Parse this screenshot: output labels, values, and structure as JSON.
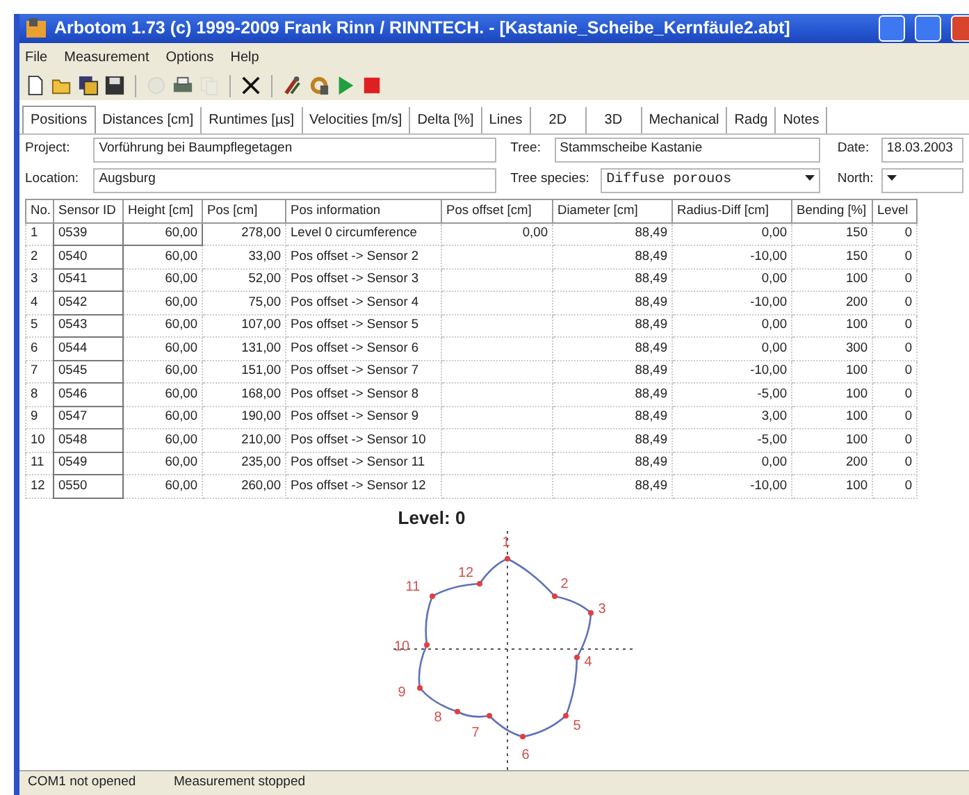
{
  "window": {
    "title": "Arbotom 1.73 (c) 1999-2009 Frank Rinn / RINNTECH.  - [Kastanie_Scheibe_Kernfäule2.abt]"
  },
  "menu": [
    "File",
    "Measurement",
    "Options",
    "Help"
  ],
  "toolbar": [
    {
      "kind": "new",
      "disabled": false
    },
    {
      "kind": "open",
      "disabled": false
    },
    {
      "kind": "saveall",
      "disabled": false
    },
    {
      "kind": "save",
      "disabled": false
    },
    {
      "kind": "sep"
    },
    {
      "kind": "print",
      "disabled": true
    },
    {
      "kind": "printer",
      "disabled": false
    },
    {
      "kind": "copy",
      "disabled": true
    },
    {
      "kind": "sep"
    },
    {
      "kind": "delete",
      "disabled": false
    },
    {
      "kind": "sep"
    },
    {
      "kind": "tools",
      "disabled": false
    },
    {
      "kind": "refresh",
      "disabled": false
    },
    {
      "kind": "play",
      "disabled": false
    },
    {
      "kind": "stop",
      "disabled": false
    }
  ],
  "tabs": [
    {
      "label": "Positions",
      "selected": true
    },
    {
      "label": "Distances [cm]",
      "selected": false
    },
    {
      "label": "Runtimes [µs]",
      "selected": false
    },
    {
      "label": "Velocities [m/s]",
      "selected": false
    },
    {
      "label": "Delta [%]",
      "selected": false
    },
    {
      "label": "Lines",
      "selected": false
    },
    {
      "label": "2D",
      "selected": false
    },
    {
      "label": "3D",
      "selected": false
    },
    {
      "label": "Mechanical",
      "selected": false
    },
    {
      "label": "Radg",
      "selected": false
    },
    {
      "label": "Notes",
      "selected": false
    }
  ],
  "form": {
    "project_label": "Project:",
    "project": "Vorführung bei Baumpflegetagen",
    "tree_label": "Tree:",
    "tree": "Stammscheibe Kastanie",
    "date_label": "Date:",
    "date": "18.03.2003",
    "location_label": "Location:",
    "location": "Augsburg",
    "species_label": "Tree species:",
    "species": "Diffuse porouos",
    "north_label": "North:"
  },
  "table": {
    "columns": [
      "No.",
      "Sensor ID",
      "Height [cm]",
      "Pos [cm]",
      "Pos information",
      "Pos offset [cm]",
      "Diameter [cm]",
      "Radius-Diff [cm]",
      "Bending [%]",
      "Level"
    ],
    "rows": [
      [
        "1",
        "0539",
        "60,00",
        "278,00",
        "Level 0 circumference",
        "0,00",
        "88,49",
        "0,00",
        "150",
        "0"
      ],
      [
        "2",
        "0540",
        "60,00",
        "33,00",
        "Pos offset -> Sensor 2",
        "",
        "88,49",
        "-10,00",
        "150",
        "0"
      ],
      [
        "3",
        "0541",
        "60,00",
        "52,00",
        "Pos offset -> Sensor 3",
        "",
        "88,49",
        "0,00",
        "100",
        "0"
      ],
      [
        "4",
        "0542",
        "60,00",
        "75,00",
        "Pos offset -> Sensor 4",
        "",
        "88,49",
        "-10,00",
        "200",
        "0"
      ],
      [
        "5",
        "0543",
        "60,00",
        "107,00",
        "Pos offset -> Sensor 5",
        "",
        "88,49",
        "0,00",
        "100",
        "0"
      ],
      [
        "6",
        "0544",
        "60,00",
        "131,00",
        "Pos offset -> Sensor 6",
        "",
        "88,49",
        "0,00",
        "300",
        "0"
      ],
      [
        "7",
        "0545",
        "60,00",
        "151,00",
        "Pos offset -> Sensor 7",
        "",
        "88,49",
        "-10,00",
        "100",
        "0"
      ],
      [
        "8",
        "0546",
        "60,00",
        "168,00",
        "Pos offset -> Sensor 8",
        "",
        "88,49",
        "-5,00",
        "100",
        "0"
      ],
      [
        "9",
        "0547",
        "60,00",
        "190,00",
        "Pos offset -> Sensor 9",
        "",
        "88,49",
        "3,00",
        "100",
        "0"
      ],
      [
        "10",
        "0548",
        "60,00",
        "210,00",
        "Pos offset -> Sensor 10",
        "",
        "88,49",
        "-5,00",
        "100",
        "0"
      ],
      [
        "11",
        "0549",
        "60,00",
        "235,00",
        "Pos offset -> Sensor 11",
        "",
        "88,49",
        "0,00",
        "200",
        "0"
      ],
      [
        "12",
        "0550",
        "60,00",
        "260,00",
        "Pos offset -> Sensor 12",
        "",
        "88,49",
        "-10,00",
        "100",
        "0"
      ]
    ]
  },
  "diagram": {
    "title": "Level: 0",
    "sensor_labels": [
      "1",
      "2",
      "3",
      "4",
      "5",
      "6",
      "7",
      "8",
      "9",
      "10",
      "11",
      "12"
    ]
  },
  "status_bar": [
    "COM1 not opened",
    "Measurement stopped"
  ]
}
